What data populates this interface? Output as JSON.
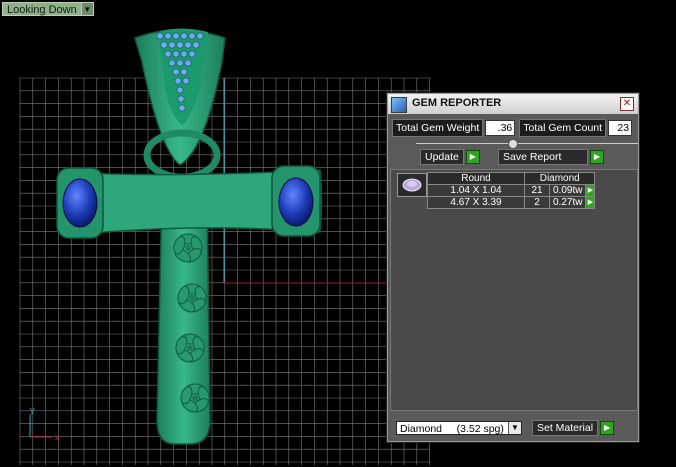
{
  "viewport": {
    "view_name": "Looking Down"
  },
  "axes": {
    "y_label": "y",
    "x_label": "x"
  },
  "panel": {
    "title": "GEM REPORTER",
    "total_weight_label": "Total Gem Weight",
    "total_weight_value": ".36",
    "total_count_label": "Total Gem Count",
    "total_count_value": "23",
    "update_label": "Update",
    "save_report_label": "Save Report",
    "table": {
      "headers": [
        "Round",
        "Diamond"
      ],
      "rows": [
        {
          "size": "1.04 X 1.04",
          "count": "21",
          "weight": "0.09tw"
        },
        {
          "size": "4.67 X 3.39",
          "count": "2",
          "weight": "0.27tw"
        }
      ]
    },
    "material_select": "Diamond     (3.52 spg)",
    "set_material_label": "Set Material"
  },
  "colors": {
    "metal": "#2fa77d",
    "gem_blue": "#1e3fb8",
    "grid": "#8a8a8a",
    "go_button": "#2ea61e"
  }
}
